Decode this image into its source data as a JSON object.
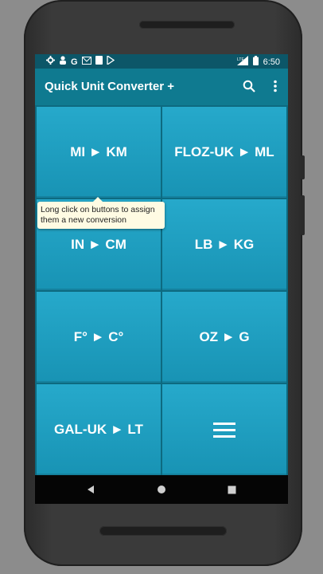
{
  "status_bar": {
    "left_icons": [
      "gear-icon",
      "person-icon",
      "google-icon",
      "gmail-icon",
      "file-icon",
      "play-store-icon"
    ],
    "network": "LTE",
    "time": "6:50"
  },
  "app_bar": {
    "title": "Quick Unit Converter +",
    "icons": [
      "search-icon",
      "more-vert-icon"
    ]
  },
  "tiles": [
    {
      "label": "MI ► KM"
    },
    {
      "label": "FLOZ-UK ► ML"
    },
    {
      "label": "IN ► CM"
    },
    {
      "label": "LB ► KG"
    },
    {
      "label": "F° ► C°"
    },
    {
      "label": "OZ ► G"
    },
    {
      "label": "GAL-UK ► LT"
    }
  ],
  "tooltip": {
    "text": "Long click on buttons to assign them a new conversion"
  },
  "colors": {
    "appbar": "#0f7a90",
    "tile": "#1fa0c2",
    "tooltip_bg": "#fffbe3"
  }
}
